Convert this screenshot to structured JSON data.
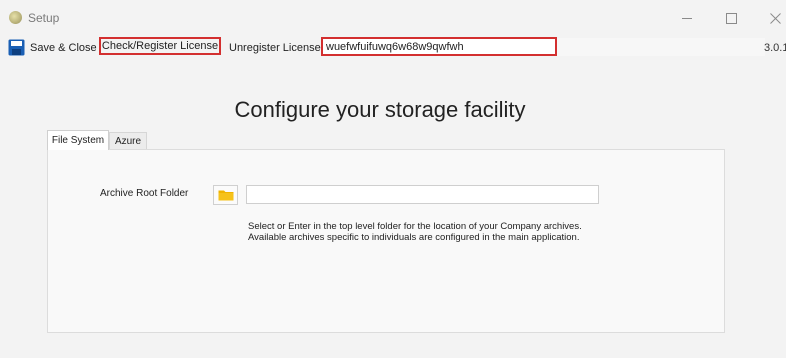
{
  "window": {
    "title": "Setup",
    "controls": {
      "minimize": "minimize-icon",
      "maximize": "maximize-icon",
      "close": "close-icon"
    }
  },
  "toolbar": {
    "save_label": "Save & Close",
    "check_register_label": "Check/Register License",
    "unregister_label": "Unregister License",
    "license_key": "wuefwfuifuwq6w68w9qwfwh",
    "version": "3.0.1",
    "highlight_color": "#d32f2f"
  },
  "main": {
    "heading": "Configure your storage facility",
    "tabs": [
      {
        "label": "File System",
        "selected": true
      },
      {
        "label": "Azure",
        "selected": false
      }
    ],
    "file_system": {
      "archive_root_label": "Archive Root Folder",
      "archive_root_value": "",
      "help_line1": "Select or Enter in the top level folder for the location of your Company archives.",
      "help_line2": "Available archives specific to individuals are configured in the main application."
    }
  },
  "colors": {
    "folder_icon": "#f0b400",
    "save_icon": "#1a5fb4"
  }
}
